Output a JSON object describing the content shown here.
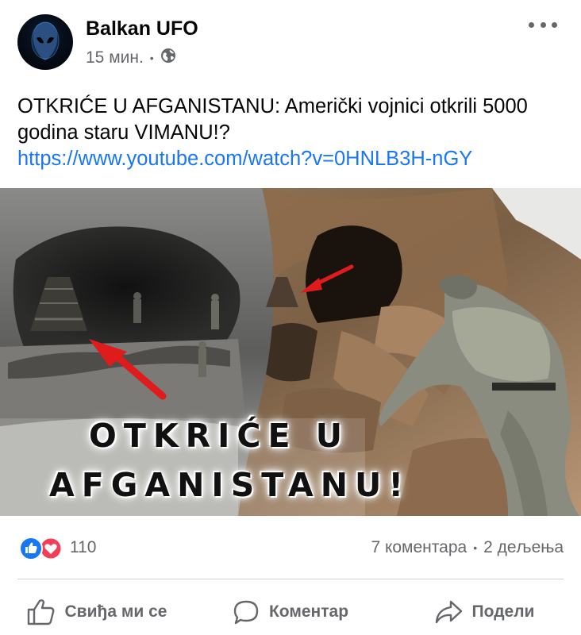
{
  "post": {
    "page_name": "Balkan UFO",
    "time": "15 мин.",
    "separator": "•",
    "audience_icon": "globe-icon",
    "more_icon": "more-dots-icon",
    "text": "OTKRIĆE U AFGANISTANU: Američki vojnici otkrili 5000 godina staru VIMANU!?",
    "link": "https://www.youtube.com/watch?v=0HNLB3H-nGY",
    "image": {
      "headline_line1": "OTKRIĆE U",
      "headline_line2": "AFGANISTANU!"
    }
  },
  "reactions": {
    "icons": [
      "like-icon",
      "love-icon"
    ],
    "count": "110",
    "comments": "7 коментара",
    "separator": "•",
    "shares": "2 дељења"
  },
  "actions": {
    "like_label": "Свиђа ми се",
    "comment_label": "Коментар",
    "share_label": "Подели"
  },
  "colors": {
    "link": "#1877f2",
    "secondary_text": "#65676b",
    "like_blue": "#1877f2",
    "love_red": "#f33e58"
  }
}
